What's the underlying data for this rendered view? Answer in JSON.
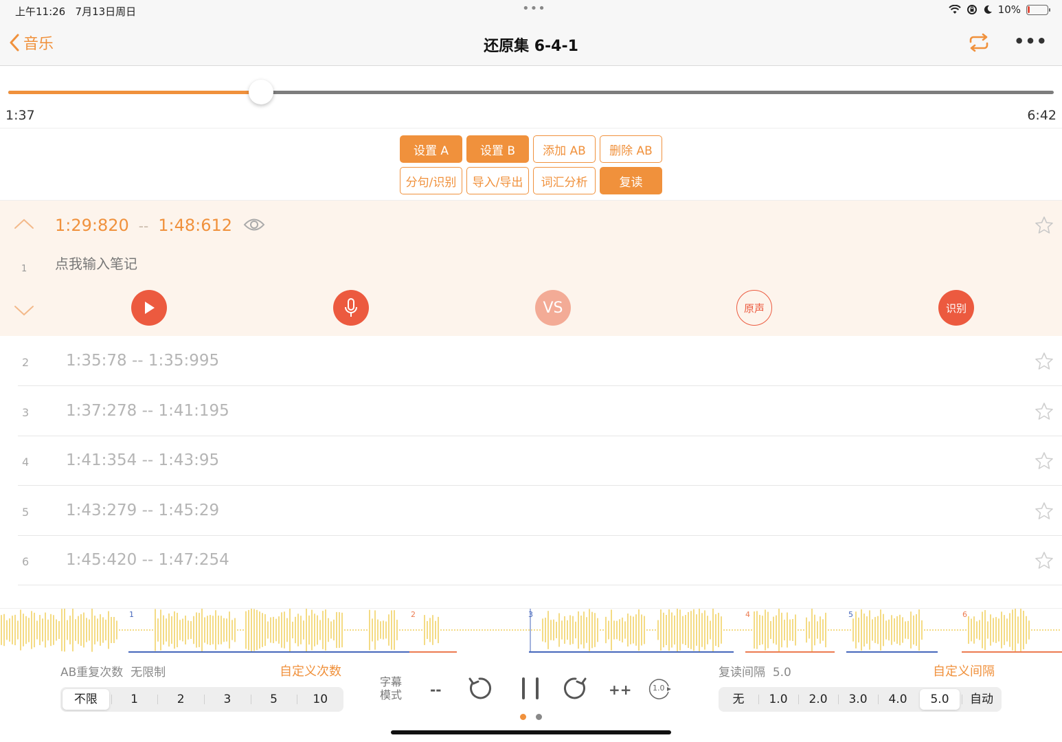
{
  "status": {
    "time": "上午11:26",
    "date": "7月13日周日",
    "battery": "10%",
    "battery_level": 0.1
  },
  "nav": {
    "back_label": "音乐",
    "title": "还原集 6-4-1"
  },
  "progress": {
    "current": "1:37",
    "total": "6:42",
    "fraction": 0.242
  },
  "buttons": {
    "row1": [
      "设置 A",
      "设置 B",
      "添加 AB",
      "删除 AB"
    ],
    "row2": [
      "分句/识别",
      "导入/导出",
      "词汇分析",
      "复读"
    ]
  },
  "active_segment": {
    "index": "1",
    "start": "1:29:820",
    "separator": "--",
    "end": "1:48:612",
    "note_placeholder": "点我输入笔记",
    "vs_label": "VS",
    "original_label": "原声",
    "recognize_label": "识别"
  },
  "segments": [
    {
      "num": "2",
      "range": "1:35:78 -- 1:35:995"
    },
    {
      "num": "3",
      "range": "1:37:278 -- 1:41:195"
    },
    {
      "num": "4",
      "range": "1:41:354 -- 1:43:95"
    },
    {
      "num": "5",
      "range": "1:43:279 -- 1:45:29"
    },
    {
      "num": "6",
      "range": "1:45:420 -- 1:47:254"
    }
  ],
  "waveform_markers": [
    "1",
    "2",
    "3",
    "4",
    "5",
    "6"
  ],
  "ab_repeat": {
    "label": "AB重复次数",
    "value": "无限制",
    "custom_label": "自定义次数",
    "options": [
      "不限",
      "1",
      "2",
      "3",
      "5",
      "10"
    ],
    "selected": "不限"
  },
  "subtitle_mode": {
    "line1": "字幕",
    "line2": "模式"
  },
  "controls": {
    "minus": "--",
    "plus": "++",
    "speed": "1.0"
  },
  "repeat_interval": {
    "label": "复读间隔",
    "value": "5.0",
    "custom_label": "自定义间隔",
    "options": [
      "无",
      "1.0",
      "2.0",
      "3.0",
      "4.0",
      "5.0",
      "自动"
    ],
    "selected": "5.0"
  },
  "colors": {
    "accent": "#f0913c",
    "red": "#ec5a3f",
    "wave": "#f1cf5a",
    "blue_marker": "#4466bb"
  }
}
